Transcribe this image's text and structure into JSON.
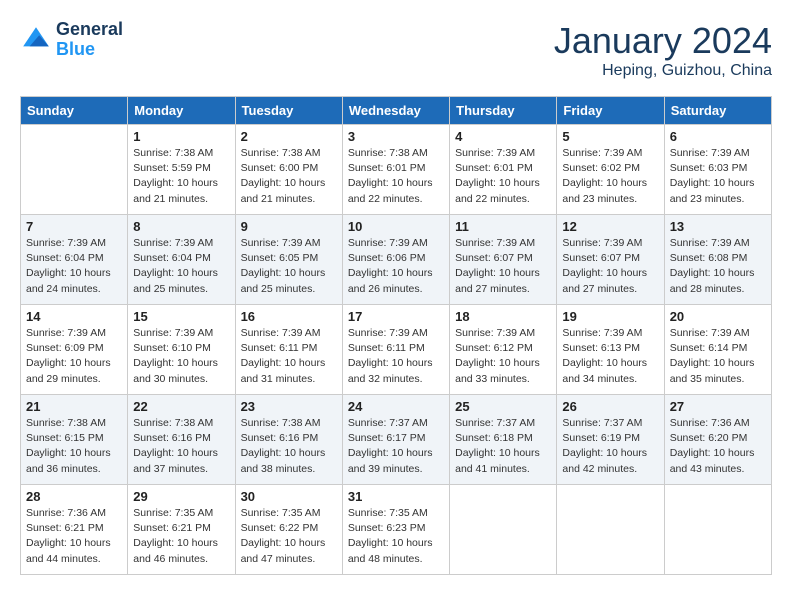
{
  "header": {
    "logo_line1": "General",
    "logo_line2": "Blue",
    "month": "January 2024",
    "location": "Heping, Guizhou, China"
  },
  "weekdays": [
    "Sunday",
    "Monday",
    "Tuesday",
    "Wednesday",
    "Thursday",
    "Friday",
    "Saturday"
  ],
  "weeks": [
    [
      {
        "day": "",
        "info": ""
      },
      {
        "day": "1",
        "info": "Sunrise: 7:38 AM\nSunset: 5:59 PM\nDaylight: 10 hours\nand 21 minutes."
      },
      {
        "day": "2",
        "info": "Sunrise: 7:38 AM\nSunset: 6:00 PM\nDaylight: 10 hours\nand 21 minutes."
      },
      {
        "day": "3",
        "info": "Sunrise: 7:38 AM\nSunset: 6:01 PM\nDaylight: 10 hours\nand 22 minutes."
      },
      {
        "day": "4",
        "info": "Sunrise: 7:39 AM\nSunset: 6:01 PM\nDaylight: 10 hours\nand 22 minutes."
      },
      {
        "day": "5",
        "info": "Sunrise: 7:39 AM\nSunset: 6:02 PM\nDaylight: 10 hours\nand 23 minutes."
      },
      {
        "day": "6",
        "info": "Sunrise: 7:39 AM\nSunset: 6:03 PM\nDaylight: 10 hours\nand 23 minutes."
      }
    ],
    [
      {
        "day": "7",
        "info": "Sunrise: 7:39 AM\nSunset: 6:04 PM\nDaylight: 10 hours\nand 24 minutes."
      },
      {
        "day": "8",
        "info": "Sunrise: 7:39 AM\nSunset: 6:04 PM\nDaylight: 10 hours\nand 25 minutes."
      },
      {
        "day": "9",
        "info": "Sunrise: 7:39 AM\nSunset: 6:05 PM\nDaylight: 10 hours\nand 25 minutes."
      },
      {
        "day": "10",
        "info": "Sunrise: 7:39 AM\nSunset: 6:06 PM\nDaylight: 10 hours\nand 26 minutes."
      },
      {
        "day": "11",
        "info": "Sunrise: 7:39 AM\nSunset: 6:07 PM\nDaylight: 10 hours\nand 27 minutes."
      },
      {
        "day": "12",
        "info": "Sunrise: 7:39 AM\nSunset: 6:07 PM\nDaylight: 10 hours\nand 27 minutes."
      },
      {
        "day": "13",
        "info": "Sunrise: 7:39 AM\nSunset: 6:08 PM\nDaylight: 10 hours\nand 28 minutes."
      }
    ],
    [
      {
        "day": "14",
        "info": "Sunrise: 7:39 AM\nSunset: 6:09 PM\nDaylight: 10 hours\nand 29 minutes."
      },
      {
        "day": "15",
        "info": "Sunrise: 7:39 AM\nSunset: 6:10 PM\nDaylight: 10 hours\nand 30 minutes."
      },
      {
        "day": "16",
        "info": "Sunrise: 7:39 AM\nSunset: 6:11 PM\nDaylight: 10 hours\nand 31 minutes."
      },
      {
        "day": "17",
        "info": "Sunrise: 7:39 AM\nSunset: 6:11 PM\nDaylight: 10 hours\nand 32 minutes."
      },
      {
        "day": "18",
        "info": "Sunrise: 7:39 AM\nSunset: 6:12 PM\nDaylight: 10 hours\nand 33 minutes."
      },
      {
        "day": "19",
        "info": "Sunrise: 7:39 AM\nSunset: 6:13 PM\nDaylight: 10 hours\nand 34 minutes."
      },
      {
        "day": "20",
        "info": "Sunrise: 7:39 AM\nSunset: 6:14 PM\nDaylight: 10 hours\nand 35 minutes."
      }
    ],
    [
      {
        "day": "21",
        "info": "Sunrise: 7:38 AM\nSunset: 6:15 PM\nDaylight: 10 hours\nand 36 minutes."
      },
      {
        "day": "22",
        "info": "Sunrise: 7:38 AM\nSunset: 6:16 PM\nDaylight: 10 hours\nand 37 minutes."
      },
      {
        "day": "23",
        "info": "Sunrise: 7:38 AM\nSunset: 6:16 PM\nDaylight: 10 hours\nand 38 minutes."
      },
      {
        "day": "24",
        "info": "Sunrise: 7:37 AM\nSunset: 6:17 PM\nDaylight: 10 hours\nand 39 minutes."
      },
      {
        "day": "25",
        "info": "Sunrise: 7:37 AM\nSunset: 6:18 PM\nDaylight: 10 hours\nand 41 minutes."
      },
      {
        "day": "26",
        "info": "Sunrise: 7:37 AM\nSunset: 6:19 PM\nDaylight: 10 hours\nand 42 minutes."
      },
      {
        "day": "27",
        "info": "Sunrise: 7:36 AM\nSunset: 6:20 PM\nDaylight: 10 hours\nand 43 minutes."
      }
    ],
    [
      {
        "day": "28",
        "info": "Sunrise: 7:36 AM\nSunset: 6:21 PM\nDaylight: 10 hours\nand 44 minutes."
      },
      {
        "day": "29",
        "info": "Sunrise: 7:35 AM\nSunset: 6:21 PM\nDaylight: 10 hours\nand 46 minutes."
      },
      {
        "day": "30",
        "info": "Sunrise: 7:35 AM\nSunset: 6:22 PM\nDaylight: 10 hours\nand 47 minutes."
      },
      {
        "day": "31",
        "info": "Sunrise: 7:35 AM\nSunset: 6:23 PM\nDaylight: 10 hours\nand 48 minutes."
      },
      {
        "day": "",
        "info": ""
      },
      {
        "day": "",
        "info": ""
      },
      {
        "day": "",
        "info": ""
      }
    ]
  ]
}
